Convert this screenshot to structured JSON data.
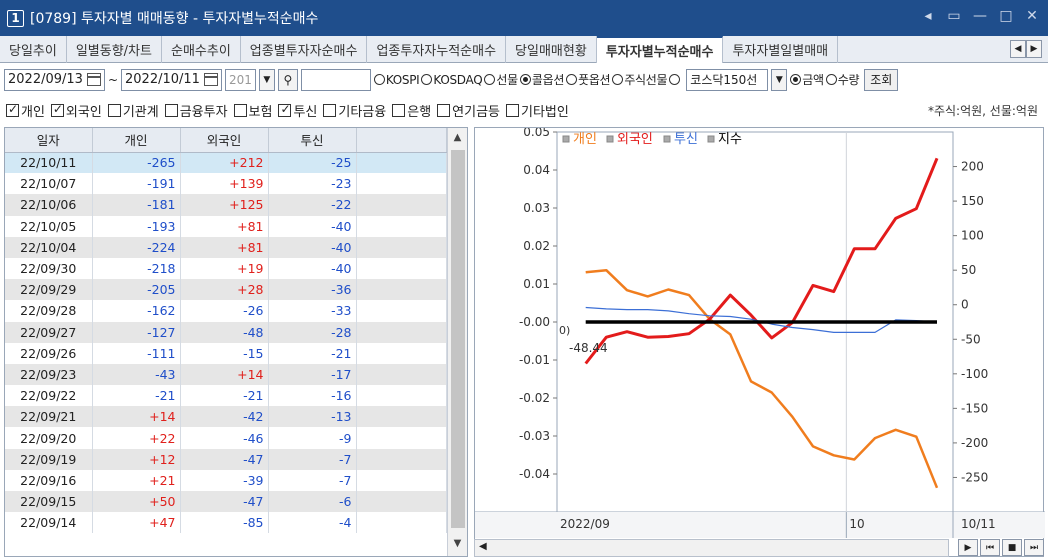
{
  "window": {
    "badge": "1",
    "title": "[0789] 투자자별 매매동향 - 투자자별누적순매수",
    "controls": [
      "◂",
      "▭",
      "—",
      "□",
      "✕"
    ]
  },
  "tabs": [
    {
      "label": "당일추이",
      "active": false
    },
    {
      "label": "일별동향/차트",
      "active": false
    },
    {
      "label": "순매수추이",
      "active": false
    },
    {
      "label": "업종별투자자순매수",
      "active": false
    },
    {
      "label": "업종투자자누적순매수",
      "active": false
    },
    {
      "label": "당일매매현황",
      "active": false
    },
    {
      "label": "투자자별누적순매수",
      "active": true
    },
    {
      "label": "투자자별일별매매",
      "active": false
    }
  ],
  "toolbar": {
    "start_date": "2022/09/13",
    "tilde": "~",
    "end_date": "2022/10/11",
    "count": "201",
    "search_value": "",
    "market_options": [
      {
        "label": "KOSPI",
        "selected": false
      },
      {
        "label": "KOSDAQ",
        "selected": false
      },
      {
        "label": "선물",
        "selected": false
      },
      {
        "label": "콜옵션",
        "selected": true
      },
      {
        "label": "풋옵션",
        "selected": false
      },
      {
        "label": "주식선물",
        "selected": false
      }
    ],
    "product_select": "코스닥150선",
    "unit_options": [
      {
        "label": "금액",
        "selected": true
      },
      {
        "label": "수량",
        "selected": false
      }
    ],
    "query_button": "조회"
  },
  "filters": [
    {
      "label": "개인",
      "checked": true
    },
    {
      "label": "외국인",
      "checked": true
    },
    {
      "label": "기관계",
      "checked": false
    },
    {
      "label": "금융투자",
      "checked": false
    },
    {
      "label": "보험",
      "checked": false
    },
    {
      "label": "투신",
      "checked": true
    },
    {
      "label": "기타금융",
      "checked": false
    },
    {
      "label": "은행",
      "checked": false
    },
    {
      "label": "연기금등",
      "checked": false
    },
    {
      "label": "기타법인",
      "checked": false
    }
  ],
  "unit_note": "*주식:억원, 선물:억원",
  "table": {
    "headers": [
      "일자",
      "개인",
      "외국인",
      "투신"
    ],
    "rows": [
      [
        "22/10/11",
        "-265",
        "+212",
        "-25"
      ],
      [
        "22/10/07",
        "-191",
        "+139",
        "-23"
      ],
      [
        "22/10/06",
        "-181",
        "+125",
        "-22"
      ],
      [
        "22/10/05",
        "-193",
        "+81",
        "-40"
      ],
      [
        "22/10/04",
        "-224",
        "+81",
        "-40"
      ],
      [
        "22/09/30",
        "-218",
        "+19",
        "-40"
      ],
      [
        "22/09/29",
        "-205",
        "+28",
        "-36"
      ],
      [
        "22/09/28",
        "-162",
        "-26",
        "-33"
      ],
      [
        "22/09/27",
        "-127",
        "-48",
        "-28"
      ],
      [
        "22/09/26",
        "-111",
        "-15",
        "-21"
      ],
      [
        "22/09/23",
        "-43",
        "+14",
        "-17"
      ],
      [
        "22/09/22",
        "-21",
        "-21",
        "-16"
      ],
      [
        "22/09/21",
        "+14",
        "-42",
        "-13"
      ],
      [
        "22/09/20",
        "+22",
        "-46",
        "-9"
      ],
      [
        "22/09/19",
        "+12",
        "-47",
        "-7"
      ],
      [
        "22/09/16",
        "+21",
        "-39",
        "-7"
      ],
      [
        "22/09/15",
        "+50",
        "-47",
        "-6"
      ],
      [
        "22/09/14",
        "+47",
        "-85",
        "-4"
      ]
    ]
  },
  "chart_data": {
    "type": "line",
    "legend": [
      {
        "name": "개인",
        "color": "#f07d1e"
      },
      {
        "name": "외국인",
        "color": "#e31b1b"
      },
      {
        "name": "투신",
        "color": "#3c6fd6"
      },
      {
        "name": "지수",
        "color": "#000000"
      }
    ],
    "left_axis": {
      "ticks": [
        "0.05",
        "0.04",
        "0.03",
        "0.02",
        "0.01",
        "-0.00",
        "-0.01",
        "-0.02",
        "-0.03",
        "-0.04"
      ],
      "min": -0.05,
      "max": 0.05
    },
    "right_axis": {
      "ticks": [
        "200",
        "150",
        "100",
        "50",
        "0",
        "-50",
        "-100",
        "-150",
        "-200",
        "-250"
      ],
      "min": -300,
      "max": 250
    },
    "x_labels": [
      "2022/09",
      "10",
      "10/11"
    ],
    "x": [
      "22/09/13",
      "22/09/14",
      "22/09/15",
      "22/09/16",
      "22/09/19",
      "22/09/20",
      "22/09/21",
      "22/09/22",
      "22/09/23",
      "22/09/26",
      "22/09/27",
      "22/09/28",
      "22/09/29",
      "22/09/30",
      "22/10/04",
      "22/10/05",
      "22/10/06",
      "22/10/07",
      "22/10/11"
    ],
    "series": [
      {
        "name": "개인",
        "axis": "right",
        "values": [
          null,
          47,
          50,
          21,
          12,
          22,
          14,
          -21,
          -43,
          -111,
          -127,
          -162,
          -205,
          -218,
          -224,
          -193,
          -181,
          -191,
          -265
        ]
      },
      {
        "name": "외국인",
        "axis": "right",
        "values": [
          null,
          -85,
          -47,
          -39,
          -47,
          -46,
          -42,
          -21,
          14,
          -15,
          -48,
          -26,
          28,
          19,
          81,
          81,
          125,
          139,
          212
        ]
      },
      {
        "name": "투신",
        "axis": "right",
        "values": [
          null,
          -4,
          -6,
          -7,
          -7,
          -9,
          -13,
          -16,
          -17,
          -21,
          -28,
          -33,
          -36,
          -40,
          -40,
          -40,
          -22,
          -23,
          -25
        ]
      },
      {
        "name": "지수",
        "axis": "left",
        "values": [
          null,
          0,
          0,
          0,
          0,
          0,
          0,
          0,
          0,
          0,
          0,
          0,
          0,
          0,
          0,
          0,
          0,
          0,
          0
        ]
      }
    ],
    "annotation": "-48.44",
    "annotation_prefix": "0)"
  },
  "scroll_nav": [
    "▶",
    "⏮",
    "■",
    "⏭"
  ]
}
